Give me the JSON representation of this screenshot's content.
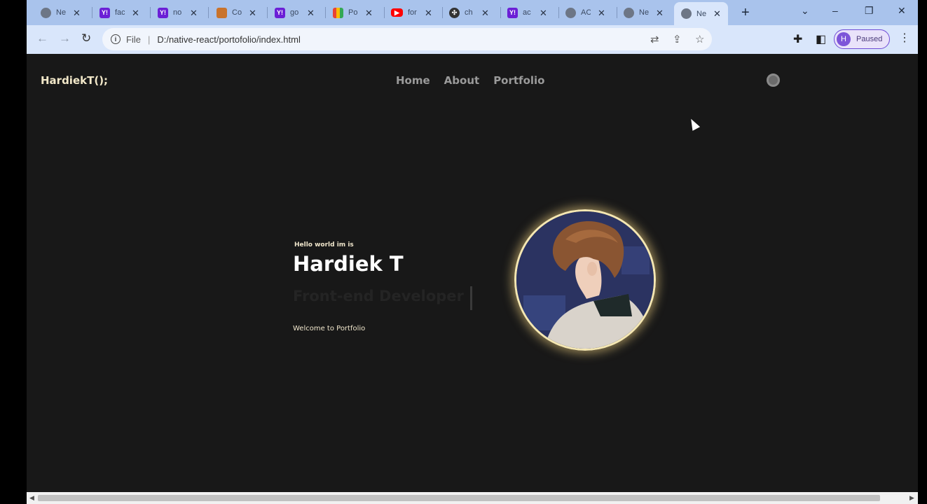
{
  "browser": {
    "tabs": [
      {
        "label": "Ne",
        "icon": "globe-icon"
      },
      {
        "label": "fac",
        "icon": "yahoo-icon"
      },
      {
        "label": "no",
        "icon": "yahoo-icon"
      },
      {
        "label": "Col",
        "icon": "cup-icon"
      },
      {
        "label": "go",
        "icon": "yahoo-icon"
      },
      {
        "label": "Po",
        "icon": "photos-icon"
      },
      {
        "label": "for",
        "icon": "youtube-icon"
      },
      {
        "label": "ch",
        "icon": "openai-icon"
      },
      {
        "label": "ac",
        "icon": "yahoo-icon"
      },
      {
        "label": "AC",
        "icon": "globe-icon"
      },
      {
        "label": "Ne",
        "icon": "globe-icon"
      },
      {
        "label": "Ne",
        "icon": "globe-icon"
      }
    ],
    "active_tab_index": 11,
    "address": {
      "scheme": "File",
      "url": "D:/native-react/portofolio/index.html"
    },
    "profile_label": "Paused",
    "profile_initial": "H"
  },
  "page": {
    "logo": "HardiekT();",
    "nav": [
      "Home",
      "About",
      "Portfolio"
    ],
    "hero": {
      "greeting": "Hello world im is",
      "name": "Hardiek T",
      "role": "Front-end Developer",
      "welcome": "Welcome to Portfolio"
    }
  },
  "colors": {
    "page_bg": "#181818",
    "accent_cream": "#f0e6cc",
    "portrait_ring": "#f5e7b2",
    "tabstrip": "#a9c3ec",
    "toolbar": "#d9e6fb"
  }
}
